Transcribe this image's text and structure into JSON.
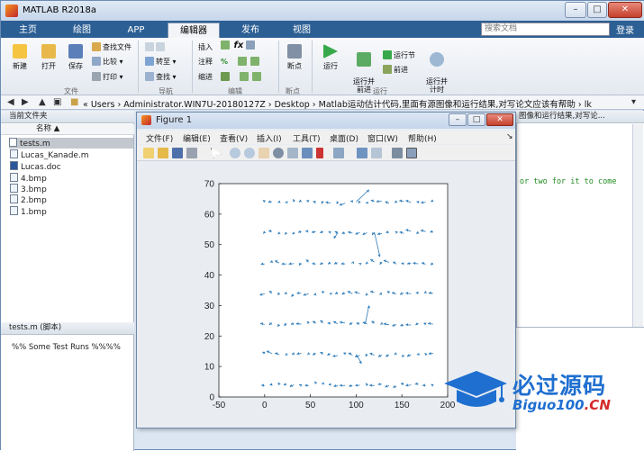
{
  "app": {
    "title": "MATLAB R2018a"
  },
  "tabs": [
    "主页",
    "绘图",
    "APP",
    "编辑器",
    "发布",
    "视图"
  ],
  "search": {
    "placeholder": "搜索文档"
  },
  "login": "登录",
  "toolstrip": {
    "file": {
      "new": "新建",
      "open": "打开",
      "save": "保存",
      "find_files": "查找文件",
      "compare": "比较",
      "print": "打印",
      "group": "文件"
    },
    "navigate": {
      "goto": "转至",
      "find": "查找",
      "group": "导航"
    },
    "edit": {
      "insert": "插入",
      "comment": "注释",
      "indent": "缩进",
      "fx": "fx",
      "group": "编辑"
    },
    "breakpoints": {
      "label": "断点",
      "group": "断点"
    },
    "run": {
      "run": "运行",
      "run_advance": "运行并\n前进",
      "run_section": "运行节",
      "advance": "前进",
      "run_time": "运行并\n计时",
      "group": "运行"
    }
  },
  "address": {
    "path": "« Users › Administrator.WIN7U-20180127Z › Desktop › Matlab运动估计代码,里面有源图像和运行结果,对写论文应该有帮助 › lk"
  },
  "current_folder": {
    "header": "当前文件夹",
    "column": "名称 ▲",
    "files": [
      "tests.m",
      "Lucas_Kanade.m",
      "Lucas.doc",
      "4.bmp",
      "3.bmp",
      "2.bmp",
      "1.bmp"
    ],
    "selected": "tests.m"
  },
  "details": {
    "header": "tests.m  (脚本)",
    "text": "%% Some Test Runs %%%%"
  },
  "editor": {
    "tab": "图像和运行结果,对写论...",
    "code": "or two for it to come"
  },
  "figure": {
    "title": "Figure 1",
    "menu": [
      "文件(F)",
      "编辑(E)",
      "查看(V)",
      "插入(I)",
      "工具(T)",
      "桌面(D)",
      "窗口(W)",
      "帮助(H)"
    ]
  },
  "chart_data": {
    "type": "scatter",
    "subtype": "quiver",
    "xlim": [
      -50,
      200
    ],
    "ylim": [
      0,
      70
    ],
    "xticks": [
      -50,
      0,
      50,
      100,
      150,
      200
    ],
    "yticks": [
      0,
      10,
      20,
      30,
      40,
      50,
      60,
      70
    ],
    "grid": false,
    "rows_y": [
      4,
      14,
      24,
      34,
      44,
      54,
      64
    ],
    "x_start": 0,
    "x_end": 190,
    "x_step": 8,
    "color": "#2e7bb9",
    "highlights": [
      {
        "x": 120,
        "y": 54,
        "u": 6,
        "v": -8
      },
      {
        "x": 100,
        "y": 64,
        "u": 14,
        "v": 4
      },
      {
        "x": 110,
        "y": 24,
        "u": 4,
        "v": 6
      },
      {
        "x": 100,
        "y": 14,
        "u": 6,
        "v": -3
      },
      {
        "x": 80,
        "y": 54,
        "u": -4,
        "v": -2
      }
    ]
  },
  "watermark": {
    "line1": "必过源码",
    "line2_a": "Biguo100",
    "line2_b": ".CN"
  }
}
